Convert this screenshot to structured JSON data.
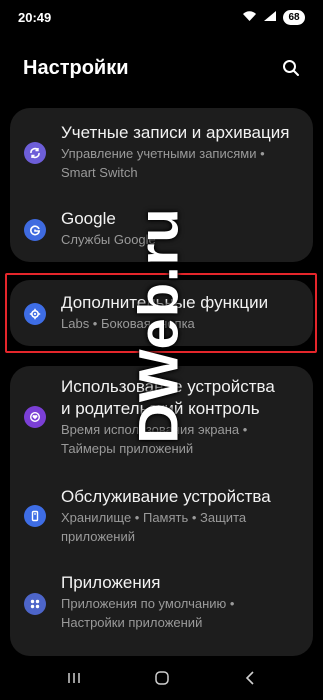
{
  "status": {
    "time": "20:49",
    "battery": "68"
  },
  "header": {
    "title": "Настройки"
  },
  "groups": [
    {
      "items": [
        {
          "title": "Учетные записи и архивация",
          "subtitle_lines": [
            "Управление учетными записями  •",
            "Smart Switch"
          ],
          "icon": "sync-icon",
          "icon_color": "#6d5ed8"
        },
        {
          "title": "Google",
          "subtitle_lines": [
            "Службы Google"
          ],
          "icon": "google-icon",
          "icon_color": "#3f6be0"
        }
      ]
    },
    {
      "items": [
        {
          "title": "Дополнительные функции",
          "subtitle_lines": [
            "Labs  •  Боковая кнопка"
          ],
          "icon": "star-gear-icon",
          "icon_color": "#3e6de5"
        }
      ]
    },
    {
      "items": [
        {
          "title_lines": [
            "Использование устройства",
            "и родительский контроль"
          ],
          "subtitle_lines": [
            "Время использования экрана  •",
            "Таймеры приложений"
          ],
          "icon": "heart-icon",
          "icon_color": "#7b3fd6"
        },
        {
          "title": "Обслуживание устройства",
          "subtitle_lines": [
            "Хранилище  •  Память  •  Защита",
            "приложений"
          ],
          "icon": "device-icon",
          "icon_color": "#3e6de5"
        },
        {
          "title": "Приложения",
          "subtitle_lines": [
            "Приложения по умолчанию  •",
            "Настройки приложений"
          ],
          "icon": "apps-icon",
          "icon_color": "#4d65c9"
        }
      ]
    }
  ],
  "watermark": "DWeb.ru",
  "nav": {
    "recents": "recents-icon",
    "home": "home-icon",
    "back": "back-icon"
  }
}
